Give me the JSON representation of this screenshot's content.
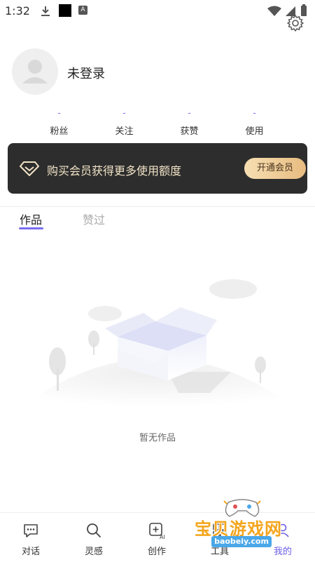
{
  "status_bar": {
    "time": "1:32",
    "a_label": "A"
  },
  "profile": {
    "username": "未登录"
  },
  "stats": [
    {
      "value": "-",
      "label": "粉丝"
    },
    {
      "value": "-",
      "label": "关注"
    },
    {
      "value": "-",
      "label": "获赞"
    },
    {
      "value": "-",
      "label": "使用"
    }
  ],
  "vip_banner": {
    "text": "购买会员获得更多使用额度",
    "button": "开通会员"
  },
  "tabs": [
    {
      "label": "作品",
      "active": true
    },
    {
      "label": "赞过",
      "active": false
    }
  ],
  "empty_state": {
    "text": "暂无作品"
  },
  "bottom_nav": [
    {
      "label": "对话",
      "icon": "chat-icon"
    },
    {
      "label": "灵感",
      "icon": "search-icon"
    },
    {
      "label": "创作",
      "icon": "ai-create-icon"
    },
    {
      "label": "工具",
      "icon": "tools-icon"
    },
    {
      "label": "我的",
      "icon": "profile-icon",
      "active": true
    }
  ],
  "watermark": {
    "title": "宝贝游戏网",
    "url": "baobeiy.com"
  },
  "colors": {
    "accent": "#7a6df0",
    "vip_bg": "#2d2d2d",
    "vip_text": "#f1e3c6",
    "vip_button": "#e8bc80"
  }
}
